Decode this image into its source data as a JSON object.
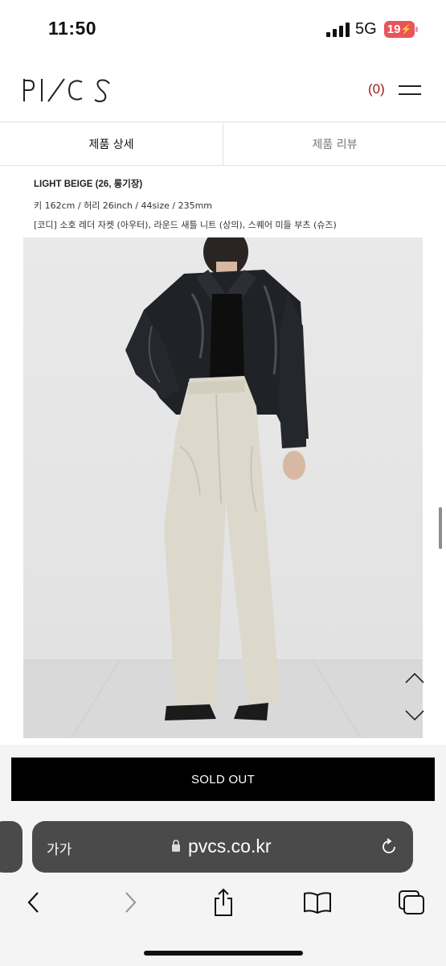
{
  "status_bar": {
    "time": "11:50",
    "network": "5G",
    "battery": "19"
  },
  "header": {
    "brand": "PVCS",
    "cart_count": "(0)"
  },
  "tabs": [
    {
      "label": "제품 상세",
      "active": true
    },
    {
      "label": "제품 리뷰",
      "active": false
    }
  ],
  "product_info": {
    "line1": "LIGHT BEIGE (26, 롱기장)",
    "line2": "키 162cm / 허리 26inch / 44size / 235mm",
    "line3": "[코디] 소호 레더 자켓 (아우터), 라운드 새틀 니트 (상의), 스퀘어 미들 부츠 (슈즈)"
  },
  "buy_button": {
    "label": "SOLD OUT"
  },
  "browser": {
    "text_size_label": "가가",
    "url": "pvcs.co.kr"
  },
  "colors": {
    "cart_accent": "#a11b1b",
    "battery_low": "#e9545a",
    "url_bar": "#4a4a4a"
  },
  "icons": [
    "signal-icon",
    "battery-icon",
    "menu-icon",
    "chevron-up-icon",
    "chevron-down-icon",
    "lock-icon",
    "reload-icon",
    "back-icon",
    "forward-icon",
    "share-icon",
    "bookmarks-icon",
    "tabs-icon"
  ]
}
